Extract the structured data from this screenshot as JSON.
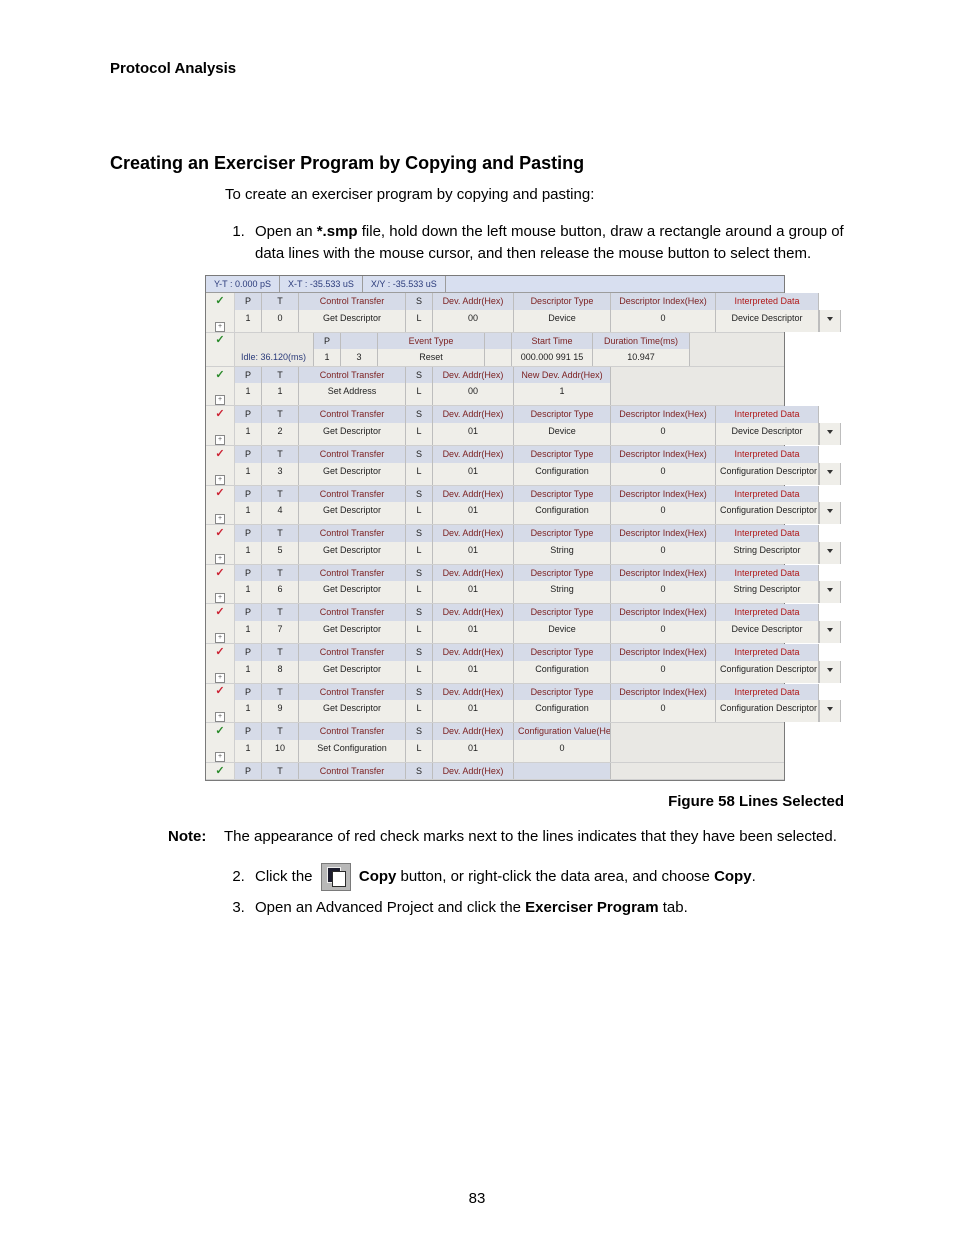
{
  "header": {
    "label": "Protocol Analysis"
  },
  "section": {
    "title": "Creating an Exerciser Program by Copying and Pasting",
    "intro": "To create an exerciser program by copying and pasting:",
    "step1_a": "Open an ",
    "step1_file": "*.smp",
    "step1_b": " file, hold down the left mouse button, draw a rectangle around a group of data lines with the mouse cursor, and then release the mouse button to select them.",
    "step2_a": "Click the ",
    "step2_b": "Copy",
    "step2_c": " button, or right-click the data area, and choose ",
    "step2_menu": "Copy",
    "step2_d": ".",
    "step3_a": "Open an Advanced Project and click the ",
    "step3_tab": "Exerciser Program",
    "step3_b": " tab."
  },
  "figure": {
    "caption": "Figure  58  Lines Selected",
    "timebar": {
      "yt": "Y-T : 0.000 pS",
      "xt": "X-T : -35.533 uS",
      "xy": "X/Y : -35.533 uS"
    },
    "idle": {
      "label": "Idle: 36.120(ms)",
      "hdr": [
        "P",
        "",
        "Event Type",
        "",
        "Start Time",
        "Duration Time(ms)"
      ],
      "val": [
        "1",
        "3",
        "Reset",
        "",
        "000.000 991 15",
        "10.947"
      ]
    },
    "hdr_common": {
      "p": "P",
      "t": "T",
      "ctrl": "Control Transfer",
      "s": "S",
      "addr": "Dev. Addr(Hex)",
      "dtype": "Descriptor Type",
      "didx": "Descriptor Index(Hex)",
      "intd": "Interpreted Data"
    },
    "rows": [
      {
        "tick": "green",
        "hdr": {
          "dtype": "Descriptor Type",
          "didx": "Descriptor Index(Hex)",
          "intd": "Interpreted Data",
          "intval": "Device Descriptor"
        },
        "val": {
          "p": "1",
          "t": "0",
          "ctrl": "Get Descriptor",
          "s": "L",
          "addr": "00",
          "dtype": "Device",
          "didx": "0"
        }
      },
      {
        "tick": "green",
        "hdr": {
          "dtype": "New Dev. Addr(Hex)",
          "didx": "",
          "intd": "",
          "intval": ""
        },
        "val": {
          "p": "1",
          "t": "1",
          "ctrl": "Set Address",
          "s": "L",
          "addr": "00",
          "dtype": "1",
          "didx": ""
        }
      },
      {
        "tick": "red",
        "hdr": {
          "dtype": "Descriptor Type",
          "didx": "Descriptor Index(Hex)",
          "intd": "Interpreted Data",
          "intval": "Device Descriptor"
        },
        "val": {
          "p": "1",
          "t": "2",
          "ctrl": "Get Descriptor",
          "s": "L",
          "addr": "01",
          "dtype": "Device",
          "didx": "0"
        }
      },
      {
        "tick": "red",
        "hdr": {
          "dtype": "Descriptor Type",
          "didx": "Descriptor Index(Hex)",
          "intd": "Interpreted Data",
          "intval": "Configuration Descriptor"
        },
        "val": {
          "p": "1",
          "t": "3",
          "ctrl": "Get Descriptor",
          "s": "L",
          "addr": "01",
          "dtype": "Configuration",
          "didx": "0"
        }
      },
      {
        "tick": "red",
        "hdr": {
          "dtype": "Descriptor Type",
          "didx": "Descriptor Index(Hex)",
          "intd": "Interpreted Data",
          "intval": "Configuration Descriptor"
        },
        "val": {
          "p": "1",
          "t": "4",
          "ctrl": "Get Descriptor",
          "s": "L",
          "addr": "01",
          "dtype": "Configuration",
          "didx": "0"
        }
      },
      {
        "tick": "red",
        "hdr": {
          "dtype": "Descriptor Type",
          "didx": "Descriptor Index(Hex)",
          "intd": "Interpreted Data",
          "intval": "String Descriptor"
        },
        "val": {
          "p": "1",
          "t": "5",
          "ctrl": "Get Descriptor",
          "s": "L",
          "addr": "01",
          "dtype": "String",
          "didx": "0"
        }
      },
      {
        "tick": "red",
        "hdr": {
          "dtype": "Descriptor Type",
          "didx": "Descriptor Index(Hex)",
          "intd": "Interpreted Data",
          "intval": "String Descriptor"
        },
        "val": {
          "p": "1",
          "t": "6",
          "ctrl": "Get Descriptor",
          "s": "L",
          "addr": "01",
          "dtype": "String",
          "didx": "0"
        }
      },
      {
        "tick": "red",
        "hdr": {
          "dtype": "Descriptor Type",
          "didx": "Descriptor Index(Hex)",
          "intd": "Interpreted Data",
          "intval": "Device Descriptor"
        },
        "val": {
          "p": "1",
          "t": "7",
          "ctrl": "Get Descriptor",
          "s": "L",
          "addr": "01",
          "dtype": "Device",
          "didx": "0"
        }
      },
      {
        "tick": "red",
        "hdr": {
          "dtype": "Descriptor Type",
          "didx": "Descriptor Index(Hex)",
          "intd": "Interpreted Data",
          "intval": "Configuration Descriptor"
        },
        "val": {
          "p": "1",
          "t": "8",
          "ctrl": "Get Descriptor",
          "s": "L",
          "addr": "01",
          "dtype": "Configuration",
          "didx": "0"
        }
      },
      {
        "tick": "red",
        "hdr": {
          "dtype": "Descriptor Type",
          "didx": "Descriptor Index(Hex)",
          "intd": "Interpreted Data",
          "intval": "Configuration Descriptor"
        },
        "val": {
          "p": "1",
          "t": "9",
          "ctrl": "Get Descriptor",
          "s": "L",
          "addr": "01",
          "dtype": "Configuration",
          "didx": "0"
        }
      },
      {
        "tick": "green",
        "hdr": {
          "dtype": "Configuration Value(Hex)",
          "didx": "",
          "intd": "",
          "intval": ""
        },
        "val": {
          "p": "1",
          "t": "10",
          "ctrl": "Set Configuration",
          "s": "L",
          "addr": "01",
          "dtype": "0",
          "didx": ""
        }
      },
      {
        "tick": "green",
        "hdr": {
          "dtype": "",
          "didx": "",
          "intd": "",
          "intval": ""
        },
        "val": {
          "p": "",
          "t": "",
          "ctrl": "Control Transfer",
          "s": "S",
          "addr": "Dev. Addr(Hex)",
          "dtype": "",
          "didx": ""
        },
        "partial": true
      }
    ]
  },
  "note": {
    "label": "Note:",
    "text": "The appearance of red check marks next to the lines indicates that they have been selected."
  },
  "page_number": "83"
}
